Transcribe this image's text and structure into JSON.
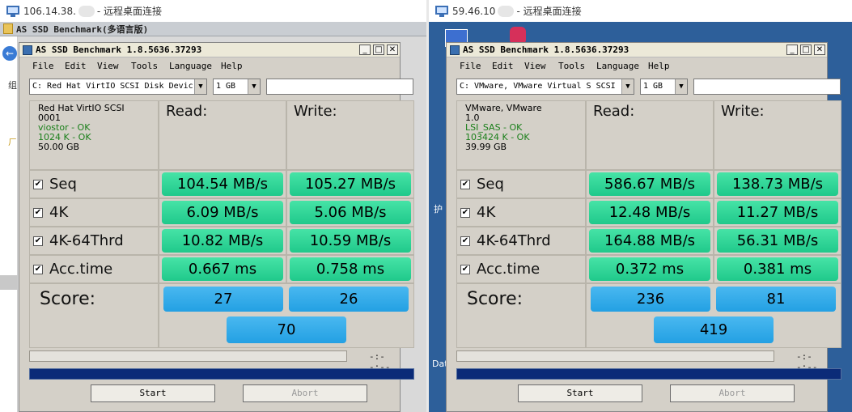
{
  "left": {
    "rdp_title_prefix": "106.14.38.",
    "rdp_title_suffix": "- 远程桌面连接",
    "explorer_title": "AS SSD Benchmark(多语言版)",
    "explorer_glyph_1": "组",
    "explorer_glyph_2": "ㄏ",
    "app": {
      "title": "AS SSD Benchmark 1.8.5636.37293",
      "menu": [
        "File",
        "Edit",
        "View",
        "Tools",
        "Language",
        "Help"
      ],
      "drive_select": "C: Red Hat VirtIO SCSI Disk Devic",
      "size_select": "1 GB",
      "info": {
        "name": "Red Hat VirtIO SCSI",
        "rev": "0001",
        "driver": "viostor - OK",
        "align": "1024 K - OK",
        "size": "50.00 GB"
      },
      "headers": {
        "read": "Read:",
        "write": "Write:"
      },
      "rows": [
        {
          "label": "Seq",
          "read": "104.54 MB/s",
          "write": "105.27 MB/s"
        },
        {
          "label": "4K",
          "read": "6.09 MB/s",
          "write": "5.06 MB/s"
        },
        {
          "label": "4K-64Thrd",
          "read": "10.82 MB/s",
          "write": "10.59 MB/s"
        },
        {
          "label": "Acc.time",
          "read": "0.667 ms",
          "write": "0.758 ms"
        }
      ],
      "score_label": "Score:",
      "score_read": "27",
      "score_write": "26",
      "score_total": "70",
      "time": "-:--:--",
      "start": "Start",
      "abort": "Abort"
    }
  },
  "right": {
    "rdp_title_prefix": "59.46.10",
    "rdp_title_suffix": "- 远程桌面连接",
    "desk_text_1": "护",
    "desk_text_2": "Dat",
    "app": {
      "title": "AS SSD Benchmark 1.8.5636.37293",
      "menu": [
        "File",
        "Edit",
        "View",
        "Tools",
        "Language",
        "Help"
      ],
      "drive_select": "C: VMware, VMware Virtual S SCSI",
      "size_select": "1 GB",
      "info": {
        "name": "VMware, VMware",
        "rev": "1.0",
        "driver": "LSI_SAS - OK",
        "align": "103424 K - OK",
        "size": "39.99 GB"
      },
      "headers": {
        "read": "Read:",
        "write": "Write:"
      },
      "rows": [
        {
          "label": "Seq",
          "read": "586.67 MB/s",
          "write": "138.73 MB/s"
        },
        {
          "label": "4K",
          "read": "12.48 MB/s",
          "write": "11.27 MB/s"
        },
        {
          "label": "4K-64Thrd",
          "read": "164.88 MB/s",
          "write": "56.31 MB/s"
        },
        {
          "label": "Acc.time",
          "read": "0.372 ms",
          "write": "0.381 ms"
        }
      ],
      "score_label": "Score:",
      "score_read": "236",
      "score_write": "81",
      "score_total": "419",
      "time": "-:--:--",
      "start": "Start",
      "abort": "Abort"
    }
  }
}
